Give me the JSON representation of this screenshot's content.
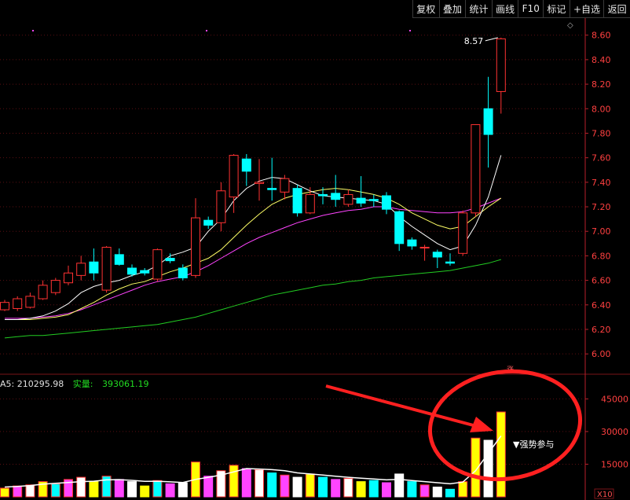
{
  "toolbar": {
    "buttons": [
      "复权",
      "叠加",
      "统计",
      "画线",
      "F10",
      "标记",
      "+自选",
      "返回"
    ]
  },
  "volume_info": {
    "ma5_label": "A5:",
    "ma5_value": "210295.98",
    "real_label": "实量:",
    "real_value": "393061.19"
  },
  "annotations": {
    "high_price": "8.57",
    "signal": "▼强势参与",
    "zoom": "X10",
    "marker": "涨"
  },
  "colors": {
    "up": "#ff3232",
    "down": "#00ffff",
    "ma5": "#ffffff",
    "ma10": "#ffff66",
    "ma20": "#ff44ff",
    "ma60": "#22cc22",
    "axis": "#b8202a",
    "vol_yellow": "#ffff00",
    "vol_magenta": "#ff44ff",
    "vol_white": "#ffffff",
    "vol_cyan": "#00ffff"
  },
  "chart_data": [
    {
      "type": "candlestick",
      "price_axis": {
        "ylim": [
          5.86,
          8.72
        ],
        "ticks": [
          "8.60",
          "8.40",
          "8.20",
          "8.00",
          "7.80",
          "7.60",
          "7.40",
          "7.20",
          "7.00",
          "6.80",
          "6.60",
          "6.40",
          "6.20",
          "6.00"
        ]
      },
      "candles": [
        {
          "o": 6.36,
          "c": 6.42,
          "h": 6.44,
          "l": 6.35
        },
        {
          "o": 6.37,
          "c": 6.45,
          "h": 6.47,
          "l": 6.35
        },
        {
          "o": 6.38,
          "c": 6.47,
          "h": 6.5,
          "l": 6.37
        },
        {
          "o": 6.45,
          "c": 6.56,
          "h": 6.6,
          "l": 6.44
        },
        {
          "o": 6.5,
          "c": 6.6,
          "h": 6.62,
          "l": 6.48
        },
        {
          "o": 6.58,
          "c": 6.66,
          "h": 6.72,
          "l": 6.56
        },
        {
          "o": 6.64,
          "c": 6.74,
          "h": 6.8,
          "l": 6.6
        },
        {
          "o": 6.75,
          "c": 6.66,
          "h": 6.86,
          "l": 6.6
        },
        {
          "o": 6.52,
          "c": 6.87,
          "h": 6.88,
          "l": 6.5
        },
        {
          "o": 6.81,
          "c": 6.73,
          "h": 6.86,
          "l": 6.72
        },
        {
          "o": 6.7,
          "c": 6.65,
          "h": 6.73,
          "l": 6.63
        },
        {
          "o": 6.68,
          "c": 6.66,
          "h": 6.7,
          "l": 6.64
        },
        {
          "o": 6.61,
          "c": 6.85,
          "h": 6.86,
          "l": 6.59
        },
        {
          "o": 6.78,
          "c": 6.76,
          "h": 6.82,
          "l": 6.74
        },
        {
          "o": 6.7,
          "c": 6.62,
          "h": 6.73,
          "l": 6.6
        },
        {
          "o": 6.64,
          "c": 7.11,
          "h": 7.27,
          "l": 6.62
        },
        {
          "o": 7.09,
          "c": 7.05,
          "h": 7.12,
          "l": 7.02
        },
        {
          "o": 7.07,
          "c": 7.33,
          "h": 7.4,
          "l": 7.0
        },
        {
          "o": 7.28,
          "c": 7.62,
          "h": 7.63,
          "l": 7.15
        },
        {
          "o": 7.59,
          "c": 7.49,
          "h": 7.63,
          "l": 7.37
        },
        {
          "o": 7.39,
          "c": 7.4,
          "h": 7.59,
          "l": 7.25
        },
        {
          "o": 7.35,
          "c": 7.34,
          "h": 7.6,
          "l": 7.25
        },
        {
          "o": 7.32,
          "c": 7.43,
          "h": 7.46,
          "l": 7.26
        },
        {
          "o": 7.35,
          "c": 7.15,
          "h": 7.38,
          "l": 7.12
        },
        {
          "o": 7.15,
          "c": 7.3,
          "h": 7.36,
          "l": 7.14
        },
        {
          "o": 7.3,
          "c": 7.29,
          "h": 7.36,
          "l": 7.22
        },
        {
          "o": 7.31,
          "c": 7.26,
          "h": 7.46,
          "l": 7.2
        },
        {
          "o": 7.22,
          "c": 7.3,
          "h": 7.34,
          "l": 7.2
        },
        {
          "o": 7.27,
          "c": 7.23,
          "h": 7.45,
          "l": 7.2
        },
        {
          "o": 7.26,
          "c": 7.25,
          "h": 7.3,
          "l": 7.2
        },
        {
          "o": 7.29,
          "c": 7.18,
          "h": 7.32,
          "l": 7.14
        },
        {
          "o": 7.16,
          "c": 6.9,
          "h": 7.17,
          "l": 6.84
        },
        {
          "o": 6.93,
          "c": 6.88,
          "h": 6.95,
          "l": 6.85
        },
        {
          "o": 6.87,
          "c": 6.87,
          "h": 6.89,
          "l": 6.76
        },
        {
          "o": 6.83,
          "c": 6.79,
          "h": 6.85,
          "l": 6.7
        },
        {
          "o": 6.75,
          "c": 6.74,
          "h": 6.82,
          "l": 6.72
        },
        {
          "o": 6.82,
          "c": 7.15,
          "h": 7.17,
          "l": 6.8
        },
        {
          "o": 7.15,
          "c": 7.87,
          "h": 7.87,
          "l": 7.12
        },
        {
          "o": 8.0,
          "c": 7.79,
          "h": 8.26,
          "l": 7.52
        },
        {
          "o": 8.14,
          "c": 8.57,
          "h": 8.58,
          "l": 7.96
        }
      ],
      "ma5": [
        6.28,
        6.28,
        6.29,
        6.31,
        6.35,
        6.41,
        6.5,
        6.55,
        6.58,
        6.6,
        6.64,
        6.67,
        6.72,
        6.8,
        6.83,
        6.87,
        7.0,
        7.1,
        7.25,
        7.35,
        7.41,
        7.44,
        7.43,
        7.38,
        7.33,
        7.29,
        7.28,
        7.27,
        7.26,
        7.25,
        7.22,
        7.12,
        7.04,
        6.97,
        6.9,
        6.85,
        6.88,
        7.05,
        7.28,
        7.62
      ],
      "ma10": [
        6.28,
        6.28,
        6.28,
        6.29,
        6.3,
        6.32,
        6.37,
        6.42,
        6.48,
        6.53,
        6.57,
        6.59,
        6.63,
        6.67,
        6.7,
        6.74,
        6.78,
        6.85,
        6.95,
        7.05,
        7.14,
        7.22,
        7.27,
        7.3,
        7.32,
        7.34,
        7.35,
        7.34,
        7.32,
        7.3,
        7.27,
        7.22,
        7.15,
        7.1,
        7.05,
        7.02,
        7.04,
        7.12,
        7.2,
        7.27
      ],
      "ma20": [
        6.29,
        6.29,
        6.29,
        6.3,
        6.31,
        6.33,
        6.36,
        6.4,
        6.44,
        6.48,
        6.52,
        6.56,
        6.59,
        6.61,
        6.63,
        6.67,
        6.72,
        6.78,
        6.84,
        6.9,
        6.95,
        6.99,
        7.03,
        7.07,
        7.1,
        7.13,
        7.15,
        7.17,
        7.18,
        7.2,
        7.2,
        7.18,
        7.17,
        7.16,
        7.15,
        7.15,
        7.16,
        7.19,
        7.23,
        7.27
      ],
      "ma60": [
        6.13,
        6.14,
        6.15,
        6.15,
        6.16,
        6.17,
        6.18,
        6.19,
        6.2,
        6.21,
        6.22,
        6.23,
        6.24,
        6.26,
        6.28,
        6.3,
        6.33,
        6.36,
        6.39,
        6.42,
        6.45,
        6.48,
        6.5,
        6.52,
        6.54,
        6.56,
        6.57,
        6.59,
        6.6,
        6.62,
        6.63,
        6.64,
        6.65,
        6.66,
        6.67,
        6.68,
        6.7,
        6.72,
        6.74,
        6.77
      ]
    },
    {
      "type": "bar",
      "title": "volume",
      "y_axis": {
        "ylim": [
          0,
          52000
        ],
        "ticks": [
          "45000",
          "30000",
          "15000"
        ]
      },
      "volumes": [
        4000,
        5000,
        5500,
        7000,
        6000,
        8000,
        9000,
        7000,
        9500,
        8000,
        7000,
        5000,
        7500,
        6000,
        6500,
        16000,
        9500,
        12000,
        14500,
        13000,
        12500,
        11000,
        10000,
        9000,
        10500,
        9000,
        8000,
        8500,
        7000,
        7500,
        6500,
        10500,
        7000,
        5500,
        4500,
        3500,
        7000,
        27000,
        26000,
        39000
      ],
      "volume_colors": [
        "yellow",
        "magenta",
        "white",
        "yellow",
        "cyan",
        "magenta",
        "white",
        "yellow",
        "cyan",
        "magenta",
        "white",
        "yellow",
        "cyan",
        "magenta",
        "white",
        "yellow",
        "magenta",
        "white",
        "yellow",
        "magenta",
        "white",
        "cyan",
        "magenta",
        "white",
        "yellow",
        "cyan",
        "magenta",
        "white",
        "yellow",
        "cyan",
        "magenta",
        "white",
        "cyan",
        "magenta",
        "white",
        "cyan",
        "yellow",
        "yellow",
        "white",
        "yellow"
      ],
      "volume_ma": [
        4500,
        4800,
        5200,
        5800,
        6200,
        6600,
        7000,
        7200,
        7800,
        7900,
        7600,
        7100,
        7200,
        6900,
        6600,
        8000,
        9000,
        10000,
        11500,
        13000,
        12800,
        12500,
        12000,
        11000,
        10500,
        10000,
        9500,
        9000,
        8600,
        8200,
        7800,
        8000,
        7500,
        7000,
        6500,
        6000,
        6800,
        12000,
        20000,
        28000
      ]
    }
  ]
}
